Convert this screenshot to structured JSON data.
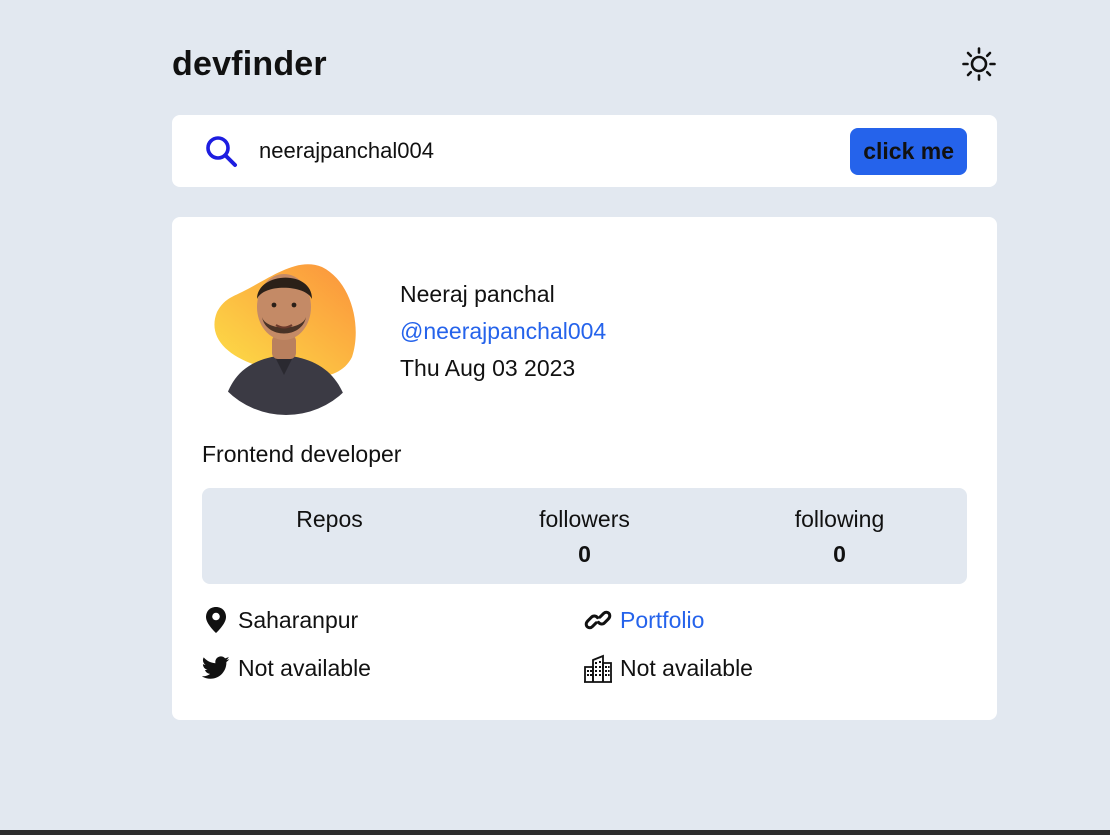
{
  "header": {
    "title": "devfinder",
    "theme_icon": "sun-icon"
  },
  "search": {
    "icon": "search-icon",
    "value": "neerajpanchal004",
    "button_label": "click me"
  },
  "profile": {
    "name": "Neeraj panchal",
    "login": "@neerajpanchal004",
    "joined": "Thu Aug 03 2023",
    "bio": "Frontend developer",
    "avatar_blob_colors": [
      "#fde047",
      "#fb923c"
    ]
  },
  "stats": [
    {
      "label": "Repos",
      "value": ""
    },
    {
      "label": "followers",
      "value": "0"
    },
    {
      "label": "following",
      "value": "0"
    }
  ],
  "links": {
    "location": {
      "icon": "map-pin-icon",
      "text": "Saharanpur"
    },
    "website": {
      "icon": "link-icon",
      "text": "Portfolio"
    },
    "twitter": {
      "icon": "twitter-icon",
      "text": "Not available"
    },
    "company": {
      "icon": "building-icon",
      "text": "Not available"
    }
  },
  "colors": {
    "background": "#e2e8f0",
    "card": "#ffffff",
    "accent": "#2563eb",
    "search_icon": "#1d1de0"
  }
}
